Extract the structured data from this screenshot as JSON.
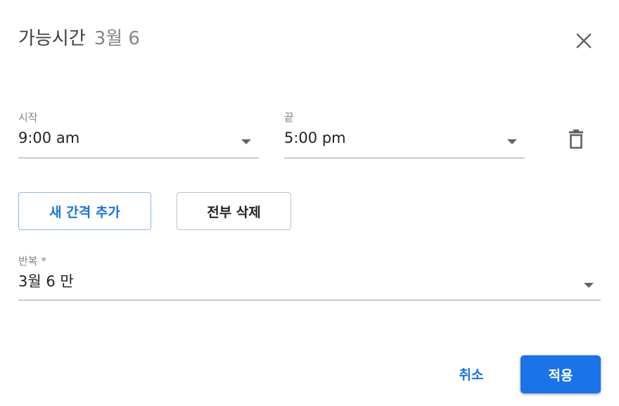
{
  "dialog": {
    "title": "가능시간",
    "date": "3월 6",
    "close_icon": "close-icon"
  },
  "start": {
    "label": "시작",
    "value": "9:00 am"
  },
  "end": {
    "label": "끝",
    "value": "5:00 pm"
  },
  "delete_icon": "trash-icon",
  "buttons": {
    "add_interval": "새 간격 추가",
    "delete_all": "전부 삭제",
    "cancel": "취소",
    "apply": "적용"
  },
  "repeat": {
    "label": "반복 *",
    "value": "3월 6 만"
  },
  "colors": {
    "accent": "#1a73e8",
    "outline_accent": "#8ab4f8",
    "text": "#202124",
    "muted": "#80868b"
  }
}
